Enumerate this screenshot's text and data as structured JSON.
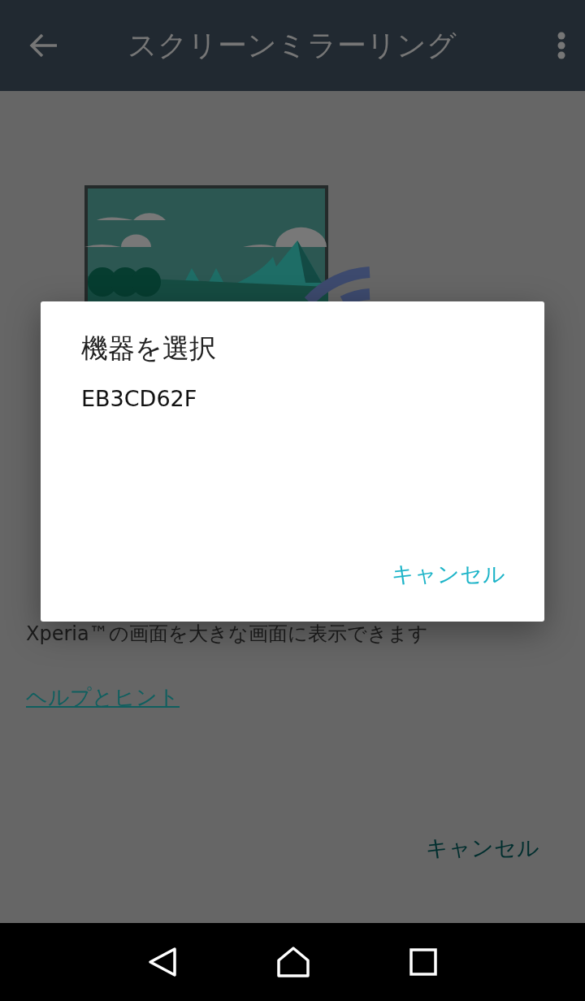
{
  "app_bar": {
    "title": "スクリーンミラーリング"
  },
  "description": "Xperia™の画面を大きな画面に表示できます",
  "help_link": "ヘルプとヒント",
  "footer_button": "キャンセル",
  "dialog": {
    "title": "機器を選択",
    "devices": [
      "EB3CD62F"
    ],
    "cancel_button": "キャンセル"
  }
}
